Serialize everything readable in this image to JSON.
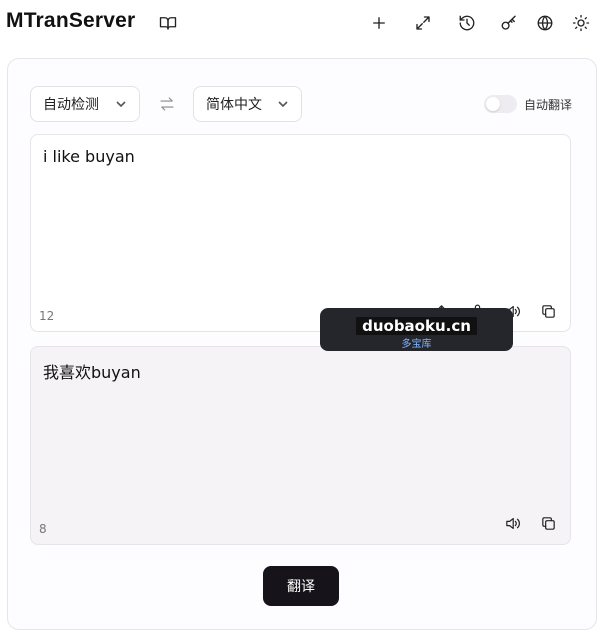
{
  "app": {
    "title": "MTranServer"
  },
  "toolbar": {
    "icons": [
      "book-icon",
      "plus-icon",
      "expand-icon",
      "history-icon",
      "key-icon",
      "globe-icon",
      "sun-icon"
    ]
  },
  "lang": {
    "source": "自动检测",
    "target": "简体中文",
    "auto_translate_label": "自动翻译",
    "auto_translate_on": false
  },
  "source_panel": {
    "text": "i like buyan",
    "char_count": "12"
  },
  "output_panel": {
    "text": "我喜欢buyan",
    "char_count": "8"
  },
  "watermark": {
    "line1": "duobaoku.cn",
    "line2": "多宝库"
  },
  "actions": {
    "translate_label": "翻译"
  }
}
